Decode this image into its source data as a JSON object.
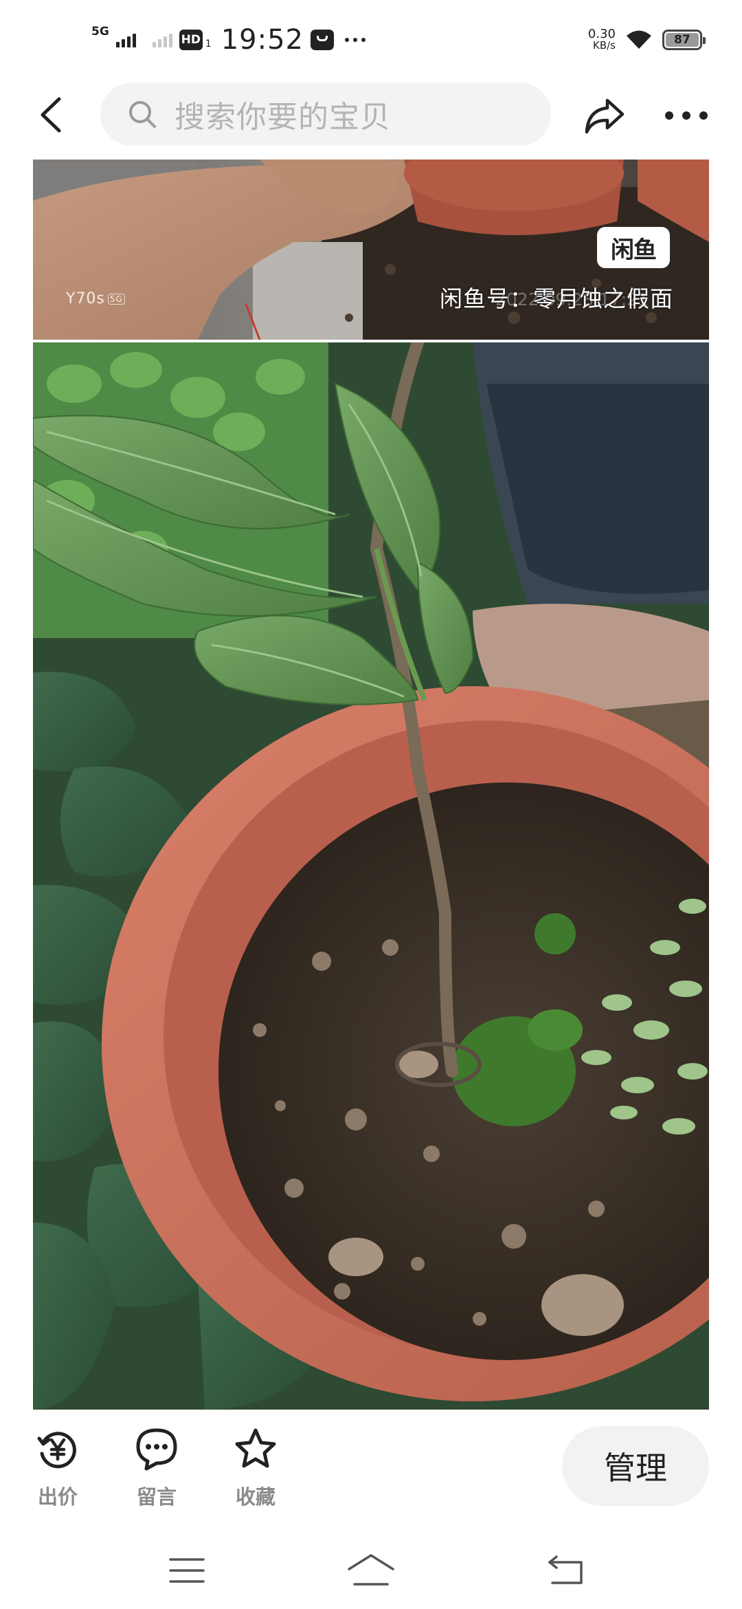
{
  "status_bar": {
    "network": "5G",
    "sim2": "HD",
    "sim2_index": "1",
    "time": "19:52",
    "speed_value": "0.30",
    "speed_unit": "KB/s",
    "battery": "87"
  },
  "nav": {
    "search_placeholder": "搜索你要的宝贝"
  },
  "image": {
    "watermark_logo": "闲鱼",
    "watermark_text": "闲鱼号：零月蚀之假面",
    "ghost_text": "2022.09.28 17:21",
    "camera_label": "Y70s",
    "camera_badge": "5G"
  },
  "actions": {
    "bid_label": "出价",
    "comment_label": "留言",
    "favorite_label": "收藏",
    "manage_label": "管理"
  },
  "colors": {
    "leaf": "#5c8f4a",
    "pot": "#c9705c",
    "soil": "#3a3128"
  }
}
